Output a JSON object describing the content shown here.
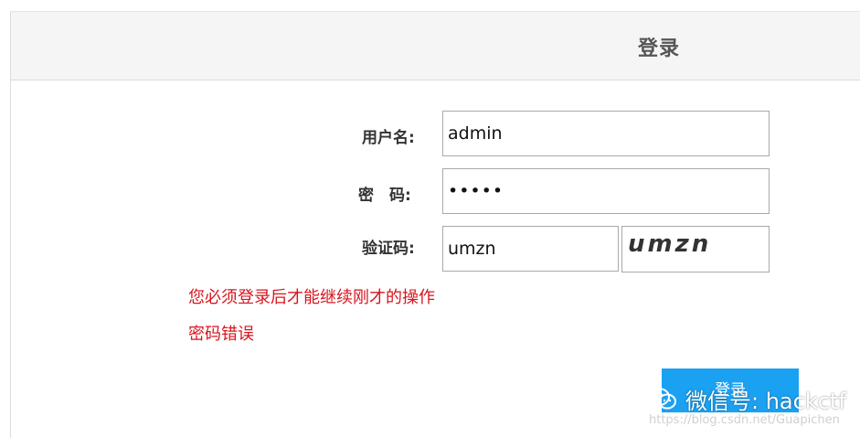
{
  "header": {
    "title": "登录"
  },
  "form": {
    "username_label": "用户名:",
    "username_value": "admin",
    "password_label": "密　码:",
    "password_value": "•••••",
    "captcha_label": "验证码:",
    "captcha_value": "umzn",
    "captcha_image_text": "umzn"
  },
  "messages": {
    "login_required": "您必须登录后才能继续刚才的操作",
    "password_error": "密码错误"
  },
  "submit": {
    "label": "登录"
  },
  "watermark": {
    "label": "微信号: hackctf",
    "url": "https://blog.csdn.net/Guapichen"
  },
  "colors": {
    "accent": "#1ba1f2",
    "error": "#d9141e",
    "header_bg": "#f5f5f5"
  }
}
